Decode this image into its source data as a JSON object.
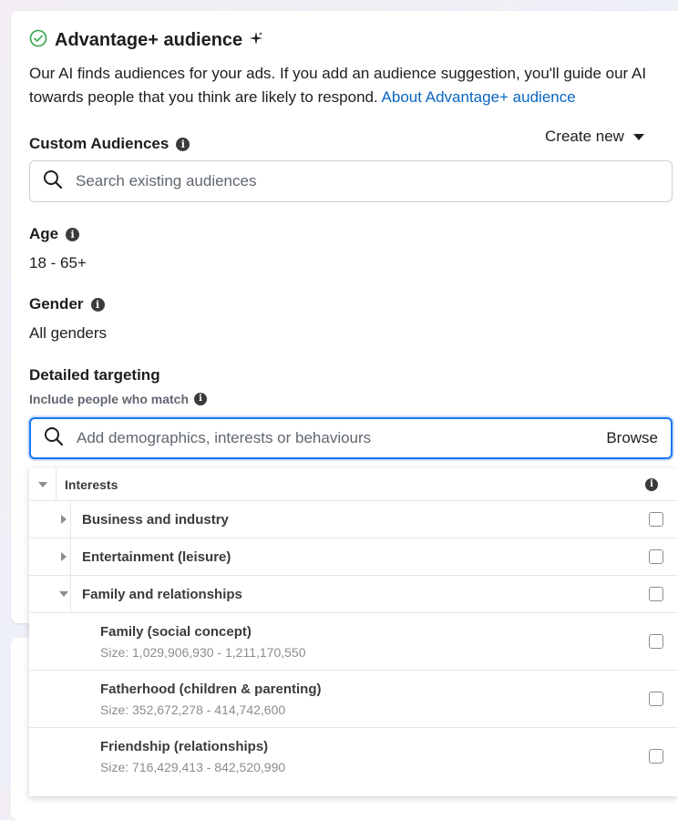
{
  "header": {
    "title": "Advantage+ audience",
    "description": "Our AI finds audiences for your ads. If you add an audience suggestion, you'll guide our AI towards people that you think are likely to respond.",
    "link": "About Advantage+ audience"
  },
  "custom_audiences": {
    "label": "Custom Audiences",
    "create_new": "Create new",
    "search_placeholder": "Search existing audiences"
  },
  "age": {
    "label": "Age",
    "value": "18 - 65+"
  },
  "gender": {
    "label": "Gender",
    "value": "All genders"
  },
  "detailed_targeting": {
    "label": "Detailed targeting",
    "sublabel": "Include people who match",
    "search_placeholder": "Add demographics, interests or behaviours",
    "browse": "Browse"
  },
  "dropdown": {
    "root": "Interests",
    "categories": [
      {
        "label": "Business and industry",
        "expanded": false
      },
      {
        "label": "Entertainment (leisure)",
        "expanded": false
      },
      {
        "label": "Family and relationships",
        "expanded": true
      }
    ],
    "items": [
      {
        "label": "Family (social concept)",
        "size": "Size: 1,029,906,930 - 1,211,170,550"
      },
      {
        "label": "Fatherhood (children & parenting)",
        "size": "Size: 352,672,278 - 414,742,600"
      },
      {
        "label": "Friendship (relationships)",
        "size": "Size: 716,429,413 - 842,520,990"
      }
    ]
  },
  "colors": {
    "accent": "#1877f2",
    "link": "#0a66c2",
    "success": "#31a24c"
  }
}
